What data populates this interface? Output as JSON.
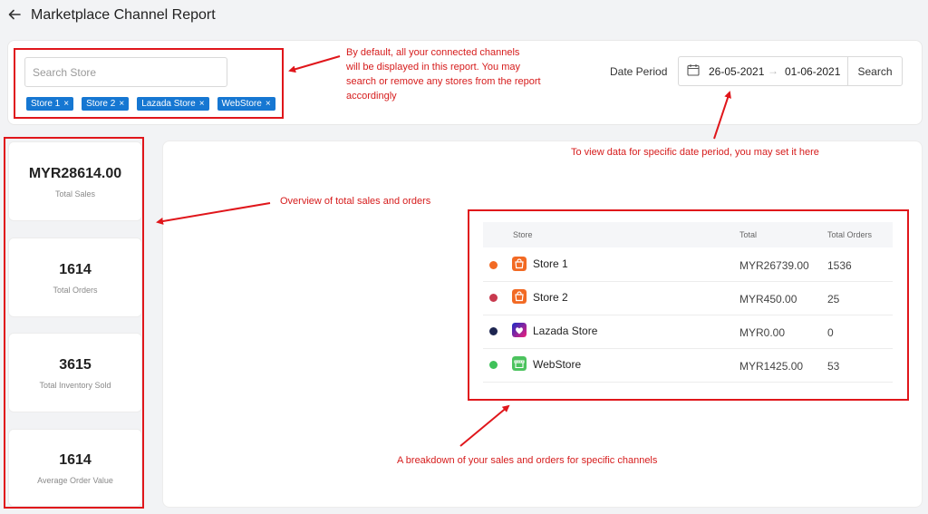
{
  "header": {
    "title": "Marketplace Channel Report"
  },
  "filters": {
    "search_placeholder": "Search Store",
    "tags": [
      "Store 1",
      "Store 2",
      "Lazada Store",
      "WebStore"
    ],
    "tag_remove_glyph": "×",
    "date_period_label": "Date Period",
    "date_start": "26-05-2021",
    "date_arrow": "→",
    "date_end": "01-06-2021",
    "search_button": "Search"
  },
  "stats": [
    {
      "value": "MYR28614.00",
      "label": "Total Sales"
    },
    {
      "value": "1614",
      "label": "Total Orders"
    },
    {
      "value": "3615",
      "label": "Total Inventory Sold"
    },
    {
      "value": "1614",
      "label": "Average Order Value"
    }
  ],
  "table": {
    "headers": {
      "store": "Store",
      "total": "Total",
      "orders": "Total Orders"
    },
    "rows": [
      {
        "store": "Store 1",
        "total": "MYR26739.00",
        "orders": "1536",
        "dot_color": "#f26a24",
        "icon": "shopee-bag-icon"
      },
      {
        "store": "Store 2",
        "total": "MYR450.00",
        "orders": "25",
        "dot_color": "#c8394e",
        "icon": "shopee-bag-icon"
      },
      {
        "store": "Lazada Store",
        "total": "MYR0.00",
        "orders": "0",
        "dot_color": "#1d2550",
        "icon": "lazada-heart-icon"
      },
      {
        "store": "WebStore",
        "total": "MYR1425.00",
        "orders": "53",
        "dot_color": "#3fc25a",
        "icon": "webstore-icon"
      }
    ]
  },
  "annotations": {
    "filter_note_line1": "By default, all your connected channels",
    "filter_note_line2": "will be displayed in this report. You may",
    "filter_note_line3": "search or remove any stores from the report",
    "filter_note_line4": "accordingly",
    "date_note": "To view data for specific date period, you may set it here",
    "overview_note": "Overview of total sales and orders",
    "breakdown_note": "A breakdown of your sales and orders for specific channels"
  },
  "colors": {
    "accent": "#1677d2",
    "annotation_red": "#e0161b"
  }
}
